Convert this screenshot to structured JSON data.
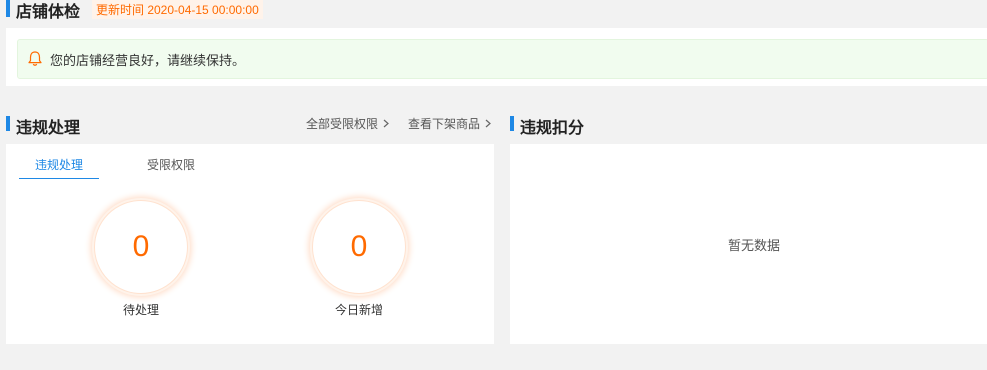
{
  "health": {
    "title": "店铺体检",
    "update_time": "更新时间 2020-04-15 00:00:00",
    "notice": "您的店铺经营良好，请继续保持。",
    "notice_icon": "bell-icon"
  },
  "violations": {
    "title": "违规处理",
    "links": {
      "restricted": "全部受限权限",
      "delisted": "查看下架商品"
    },
    "tabs": [
      "违规处理",
      "受限权限"
    ],
    "active_tab": 0,
    "stats": [
      {
        "value": "0",
        "label": "待处理"
      },
      {
        "value": "0",
        "label": "今日新增"
      }
    ]
  },
  "deductions": {
    "title": "违规扣分",
    "empty_text": "暂无数据"
  },
  "colors": {
    "accent": "#1e88e5",
    "highlight": "#ff6a00",
    "notice_bg": "#f1fcef"
  }
}
